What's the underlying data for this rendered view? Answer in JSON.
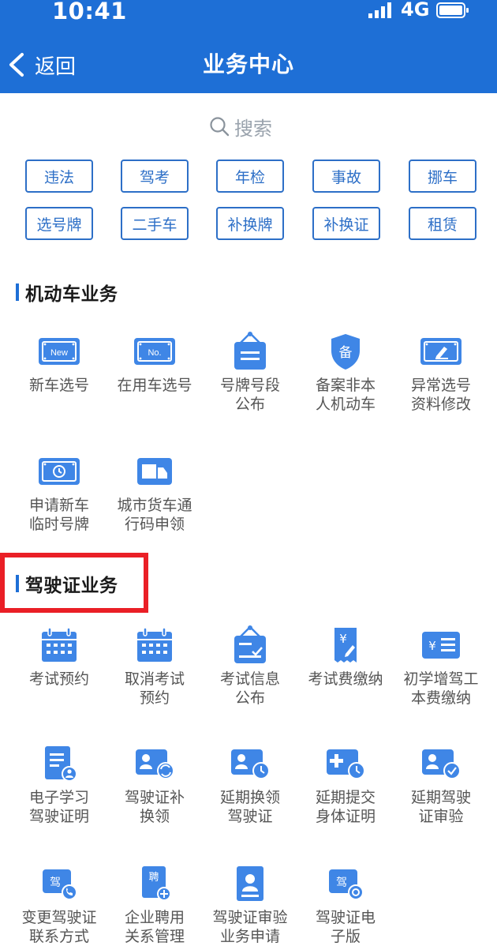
{
  "status_bar": {
    "time": "10:41",
    "network": "4G"
  },
  "nav": {
    "back_label": "返回",
    "title": "业务中心"
  },
  "search": {
    "label": "搜索"
  },
  "quick_tags": [
    "违法",
    "驾考",
    "年检",
    "事故",
    "挪车",
    "选号牌",
    "二手车",
    "补换牌",
    "补换证",
    "租赁"
  ],
  "sections": {
    "vehicle": {
      "title": "机动车业务",
      "items": [
        {
          "label": "新车选号",
          "icon": "new-plate-icon",
          "icon_text": "New"
        },
        {
          "label": "在用车选号",
          "icon": "in-use-plate-icon",
          "icon_text": "No."
        },
        {
          "label": "号牌号段\n公布",
          "icon": "plate-notice-icon"
        },
        {
          "label": "备案非本\n人机动车",
          "icon": "record-shield-icon",
          "icon_text": "备"
        },
        {
          "label": "异常选号\n资料修改",
          "icon": "edit-plate-icon"
        },
        {
          "label": "申请新车\n临时号牌",
          "icon": "temp-plate-icon"
        },
        {
          "label": "城市货车通\n行码申领",
          "icon": "truck-pass-icon"
        }
      ]
    },
    "license": {
      "title": "驾驶证业务",
      "items": [
        {
          "label": "考试预约",
          "icon": "exam-calendar-icon"
        },
        {
          "label": "取消考试\n预约",
          "icon": "cancel-calendar-icon"
        },
        {
          "label": "考试信息\n公布",
          "icon": "exam-notice-icon"
        },
        {
          "label": "考试费缴纳",
          "icon": "exam-fee-icon",
          "icon_text": "¥"
        },
        {
          "label": "初学增驾工\n本费缴纳",
          "icon": "cost-fee-icon",
          "icon_text": "¥"
        },
        {
          "label": "电子学习\n驾驶证明",
          "icon": "study-proof-icon"
        },
        {
          "label": "驾驶证补\n换领",
          "icon": "license-reissue-icon"
        },
        {
          "label": "延期换领\n驾驶证",
          "icon": "delay-renew-icon"
        },
        {
          "label": "延期提交\n身体证明",
          "icon": "delay-health-icon"
        },
        {
          "label": "延期驾驶\n证审验",
          "icon": "delay-audit-icon"
        },
        {
          "label": "变更驾驶证\n联系方式",
          "icon": "change-contact-icon",
          "icon_text": "驾"
        },
        {
          "label": "企业聘用\n关系管理",
          "icon": "employment-icon",
          "icon_text": "聘"
        },
        {
          "label": "驾驶证审验\n业务申请",
          "icon": "audit-apply-icon"
        },
        {
          "label": "驾驶证电\n子版",
          "icon": "e-license-icon",
          "icon_text": "驾"
        }
      ]
    }
  },
  "colors": {
    "header": "#1e6fd6",
    "accent": "#2d6fc7",
    "highlight": "#ea1f26"
  }
}
